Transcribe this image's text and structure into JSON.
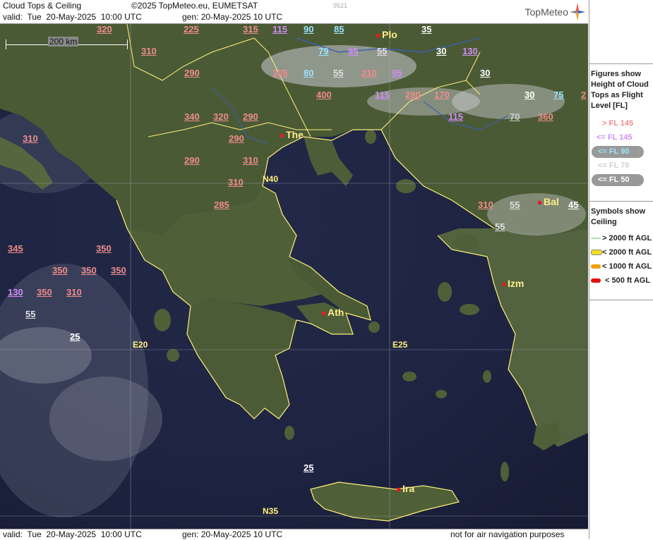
{
  "header": {
    "title": "Cloud Tops & Ceiling",
    "copyright": "©2025 TopMeteo.eu, EUMETSAT",
    "id": "9521",
    "valid": "valid:  Tue  20-May-2025  10:00 UTC",
    "gen": "gen: 20-May-2025 10 UTC",
    "logo": "TopMeteo"
  },
  "footer": {
    "valid": "valid:  Tue  20-May-2025  10:00 UTC",
    "gen": "gen: 20-May-2025 10 UTC",
    "disclaimer": "not for air navigation purposes"
  },
  "scale": "200 km",
  "grid": {
    "n40": "N40",
    "n35": "N35",
    "e20": "E20",
    "e25": "E25"
  },
  "cities": {
    "plo": "Plo",
    "the": "The",
    "bal": "Bal",
    "izm": "Izm",
    "ath": "Ath",
    "ira": "Ira"
  },
  "legend": {
    "fig_title": "Figures show Height of Cloud Tops as Flight Level  [FL]",
    "gt145": "> FL 145",
    "le145": "<= FL 145",
    "le90": "<= FL 90",
    "le70": "<= FL 70",
    "le50": "<= FL 50",
    "sym_title": "Symbols show Ceiling",
    "s2000a": "> 2000 ft AGL",
    "s2000b": "< 2000 ft AGL",
    "s1000": "< 1000 ft AGL",
    "s500": "< 500 ft AGL",
    "colors": {
      "hi": "#f08c8c",
      "mid": "#d18ef5",
      "lo": "#9be3ff",
      "ceil_hi": "#a8e6a8",
      "ceil_2000": "#f2e020",
      "ceil_1000": "#f0a000",
      "ceil_500": "#e01010"
    }
  },
  "labels": {
    "l01": "320",
    "l02": "225",
    "l03": "315",
    "l04": "115",
    "l05": "90",
    "l06": "85",
    "l07": "35",
    "l08": "310",
    "l09": "79",
    "l10": "95",
    "l11": "55",
    "l12": "30",
    "l13": "130",
    "l14": "290",
    "l15": "305",
    "l16": "80",
    "l17": "55",
    "l18": "210",
    "l19": "95",
    "l20": "30",
    "l21": "400",
    "l22": "115",
    "l23": "280",
    "l24": "170",
    "l25": "30",
    "l26": "75",
    "l27": "2",
    "l28": "340",
    "l29": "320",
    "l30": "290",
    "l31": "115",
    "l32": "70",
    "l33": "360",
    "l34": "310",
    "l35": "290",
    "l36": "290",
    "l37": "310",
    "l38": "310",
    "l39": "285",
    "l40": "310",
    "l41": "55",
    "l42": "45",
    "l43": "55",
    "l44": "345",
    "l45": "350",
    "l46": "350",
    "l47": "350",
    "l48": "350",
    "l49": "130",
    "l50": "350",
    "l51": "310",
    "l52": "55",
    "l53": "25",
    "l54": "25"
  }
}
